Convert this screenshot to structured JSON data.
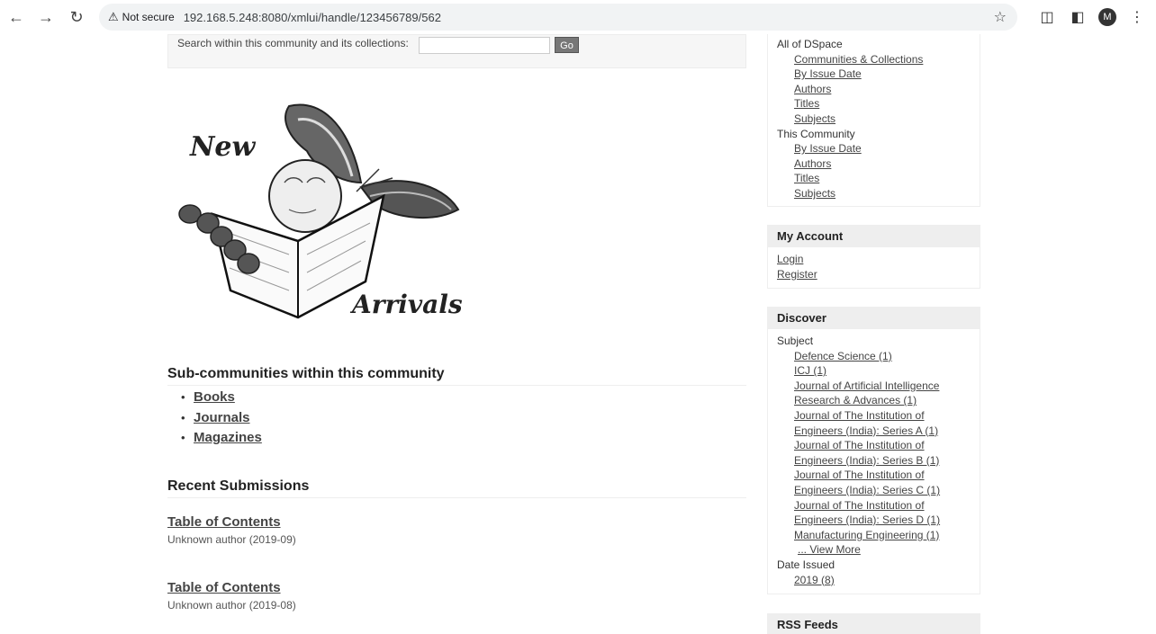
{
  "browser": {
    "security_label": "Not secure",
    "url": "192.168.5.248:8080/xmlui/handle/123456789/562",
    "profile_initial": "M"
  },
  "search": {
    "label": "Search within this community and its collections:",
    "input_value": "",
    "go_label": "Go"
  },
  "banner": {
    "word_top": "New",
    "word_bottom": "Arrivals"
  },
  "subcommunities": {
    "heading": "Sub-communities within this community",
    "items": [
      "Books",
      "Journals",
      "Magazines"
    ]
  },
  "recent": {
    "heading": "Recent Submissions",
    "items": [
      {
        "title": "Table of Contents",
        "meta": "Unknown author (2019-09)"
      },
      {
        "title": "Table of Contents",
        "meta": "Unknown author (2019-08)"
      }
    ]
  },
  "browse": {
    "all_label": "All of DSpace",
    "all_links": [
      "Communities & Collections",
      "By Issue Date",
      "Authors",
      "Titles",
      "Subjects"
    ],
    "community_label": "This Community",
    "community_links": [
      "By Issue Date",
      "Authors",
      "Titles",
      "Subjects"
    ]
  },
  "account": {
    "heading": "My Account",
    "links": [
      "Login",
      "Register"
    ]
  },
  "discover": {
    "heading": "Discover",
    "subject_label": "Subject",
    "subject_lines": [
      "Defence Science (1)",
      "ICJ (1)",
      "Journal of Artificial Intelligence",
      "Research & Advances (1)",
      "Journal of The Institution of",
      "Engineers (India): Series A (1)",
      "Journal of The Institution of",
      "Engineers (India): Series B (1)",
      "Journal of The Institution of",
      "Engineers (India): Series C (1)",
      "Journal of The Institution of",
      "Engineers (India): Series D (1)",
      "Manufacturing Engineering (1)",
      "... View More"
    ],
    "date_label": "Date Issued",
    "date_links": [
      "2019 (8)"
    ]
  },
  "rss": {
    "heading": "RSS Feeds"
  }
}
